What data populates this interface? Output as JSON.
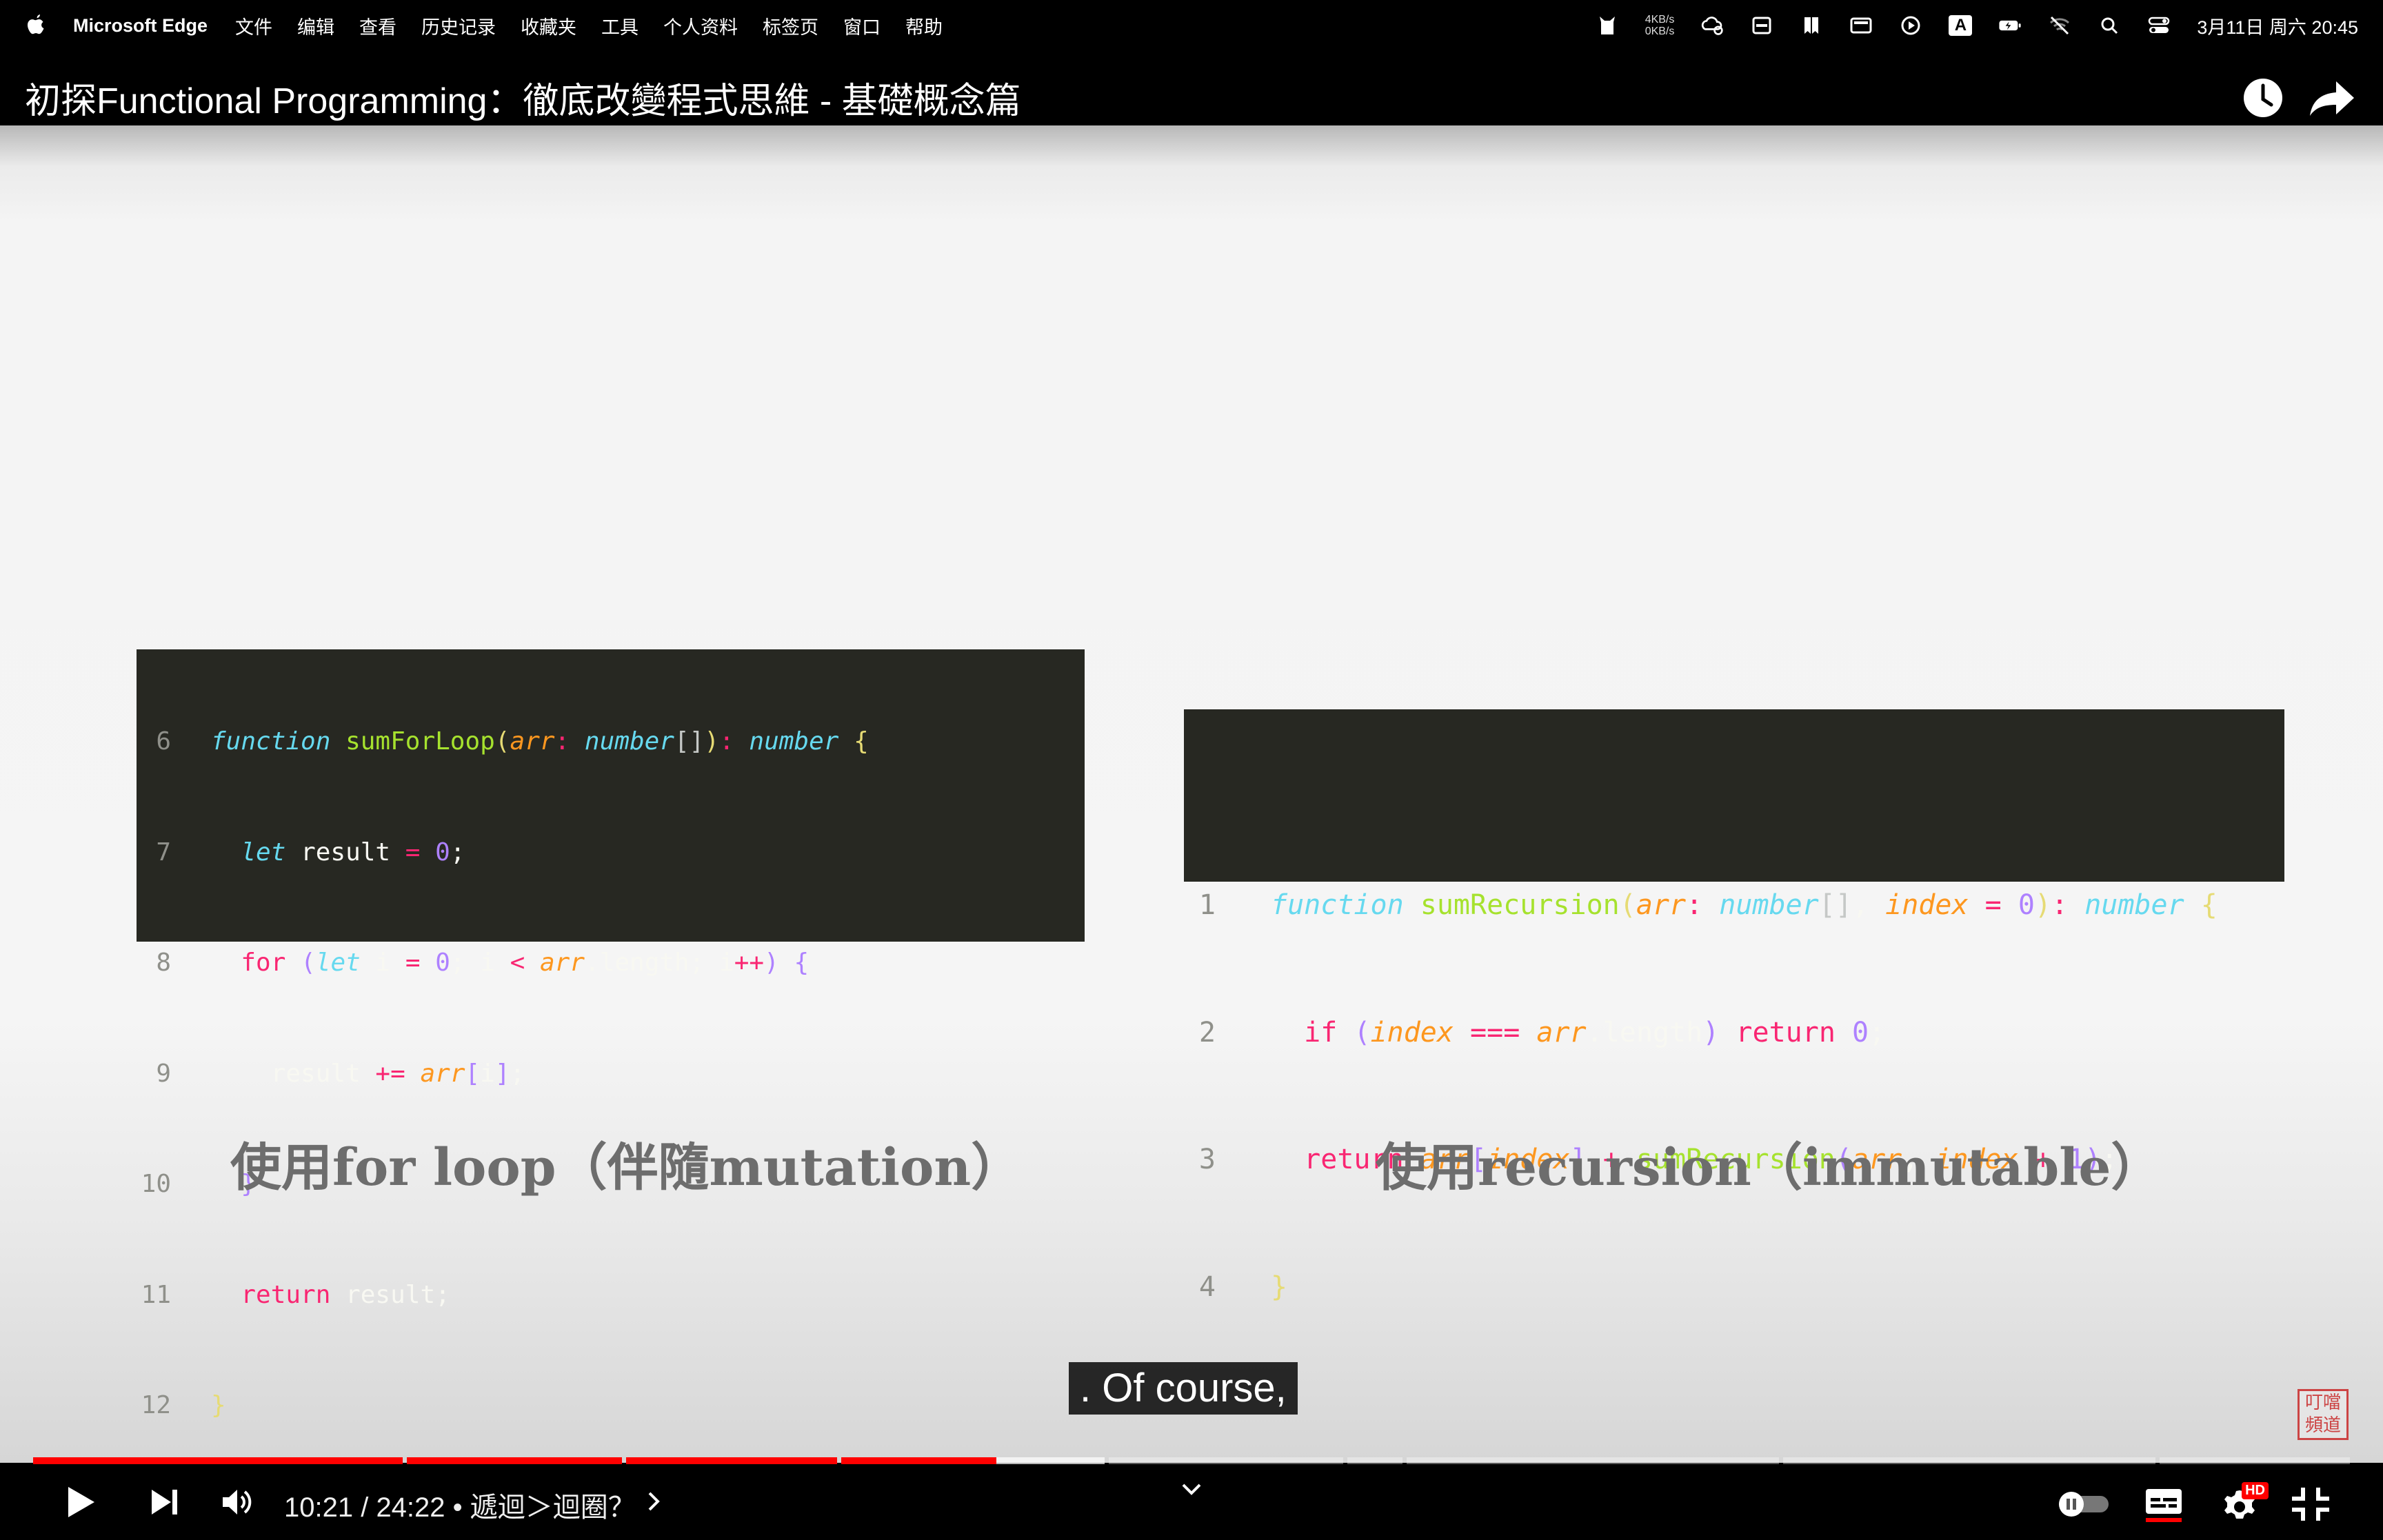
{
  "menubar": {
    "app_name": "Microsoft Edge",
    "menus": [
      "文件",
      "编辑",
      "查看",
      "历史记录",
      "收藏夹",
      "工具",
      "个人资料",
      "标签页",
      "窗口",
      "帮助"
    ],
    "net_up": "4KB/s",
    "net_down": "0KB/s",
    "input_method": "A",
    "datetime": "3月11日 周六  20:45",
    "icons": [
      "apple-icon",
      "cat-icon",
      "network-speed",
      "weather-icon",
      "window-icon",
      "bookmark-icon",
      "display-icon",
      "play-circle-icon",
      "input-method-icon",
      "battery-icon",
      "wifi-off-icon",
      "search-icon",
      "control-center-icon"
    ]
  },
  "video": {
    "title": "初探Functional Programming：徹底改變程式思維 - 基礎概念篇",
    "subtitle": ". Of course,",
    "watermark": "叮噹頻道",
    "labels": {
      "left": "使用for loop（伴隨mutation）",
      "right": "使用recursion（immutable）"
    }
  },
  "player": {
    "current_time": "10:21",
    "duration": "24:22",
    "chapter": "遞迴＞迴圈？",
    "time_text": "10:21 / 24:22 • 遞迴＞迴圈？",
    "progress_fraction": 0.425,
    "hd_label": "HD",
    "accent_color": "#ff0000"
  }
}
